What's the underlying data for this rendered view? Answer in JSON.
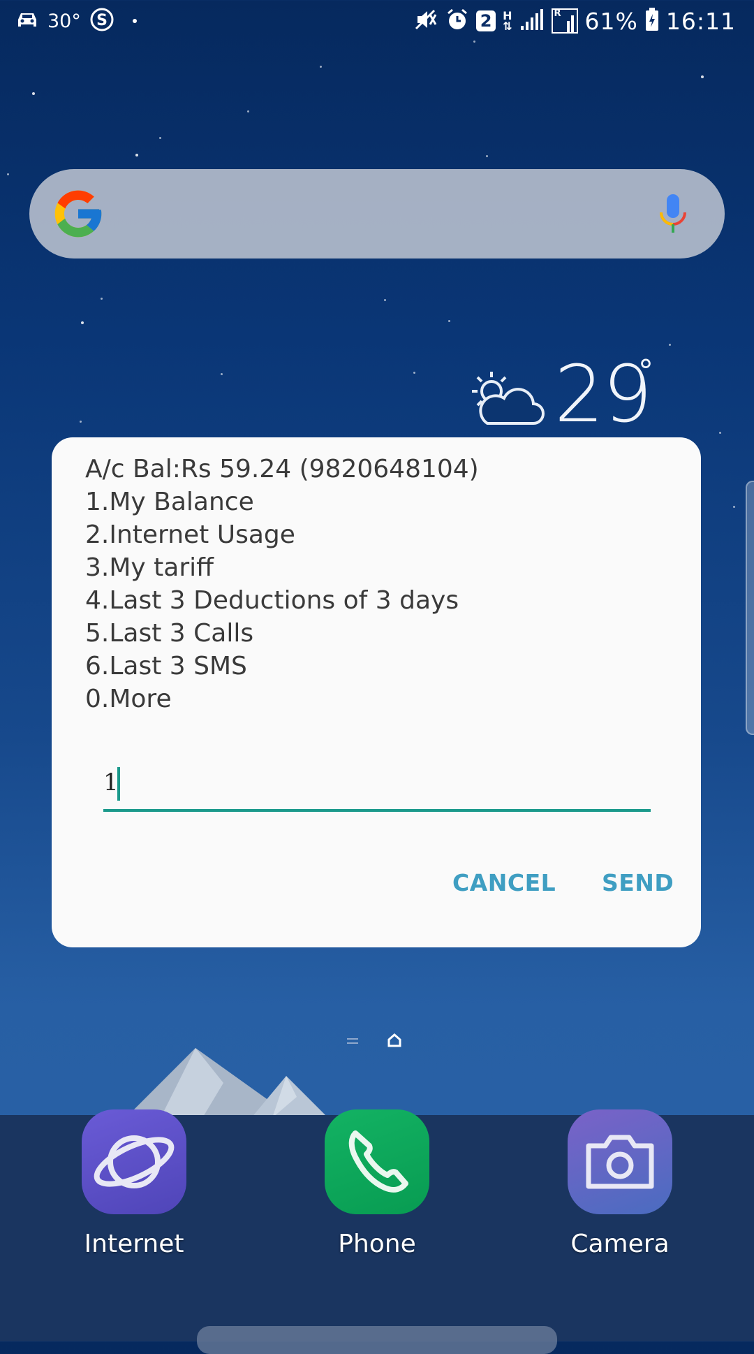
{
  "status_bar": {
    "temperature": "30°",
    "network_type": "H",
    "notification_count": "2",
    "roaming": "R",
    "battery": "61%",
    "time": "16:11",
    "icons": [
      "car-icon",
      "skype-icon",
      "dot-icon",
      "mute-icon",
      "alarm-icon",
      "signal-icon",
      "battery-icon"
    ]
  },
  "weather_widget": {
    "temperature": "29",
    "degree": "°",
    "icon": "partly-cloudy-icon"
  },
  "search_bar": {
    "logo": "google-icon",
    "mic": "mic-icon"
  },
  "dialog": {
    "lines": [
      "A/c Bal:Rs 59.24 (9820648104)",
      "1.My Balance",
      "2.Internet Usage",
      "3.My tariff",
      "4.Last 3 Deductions of 3 days",
      "5.Last 3 Calls",
      "6.Last 3 SMS",
      "0.More"
    ],
    "input_value": "1",
    "cancel_label": "CANCEL",
    "send_label": "SEND",
    "accent_color": "#1b998b",
    "button_color": "#3f9ec2"
  },
  "dock": {
    "apps": [
      {
        "label": "Internet",
        "icon": "internet-icon",
        "color": "#5b4fc4"
      },
      {
        "label": "Phone",
        "icon": "phone-icon",
        "color": "#0ea55a"
      },
      {
        "label": "Camera",
        "icon": "camera-icon",
        "color": "#5660c0"
      }
    ]
  }
}
